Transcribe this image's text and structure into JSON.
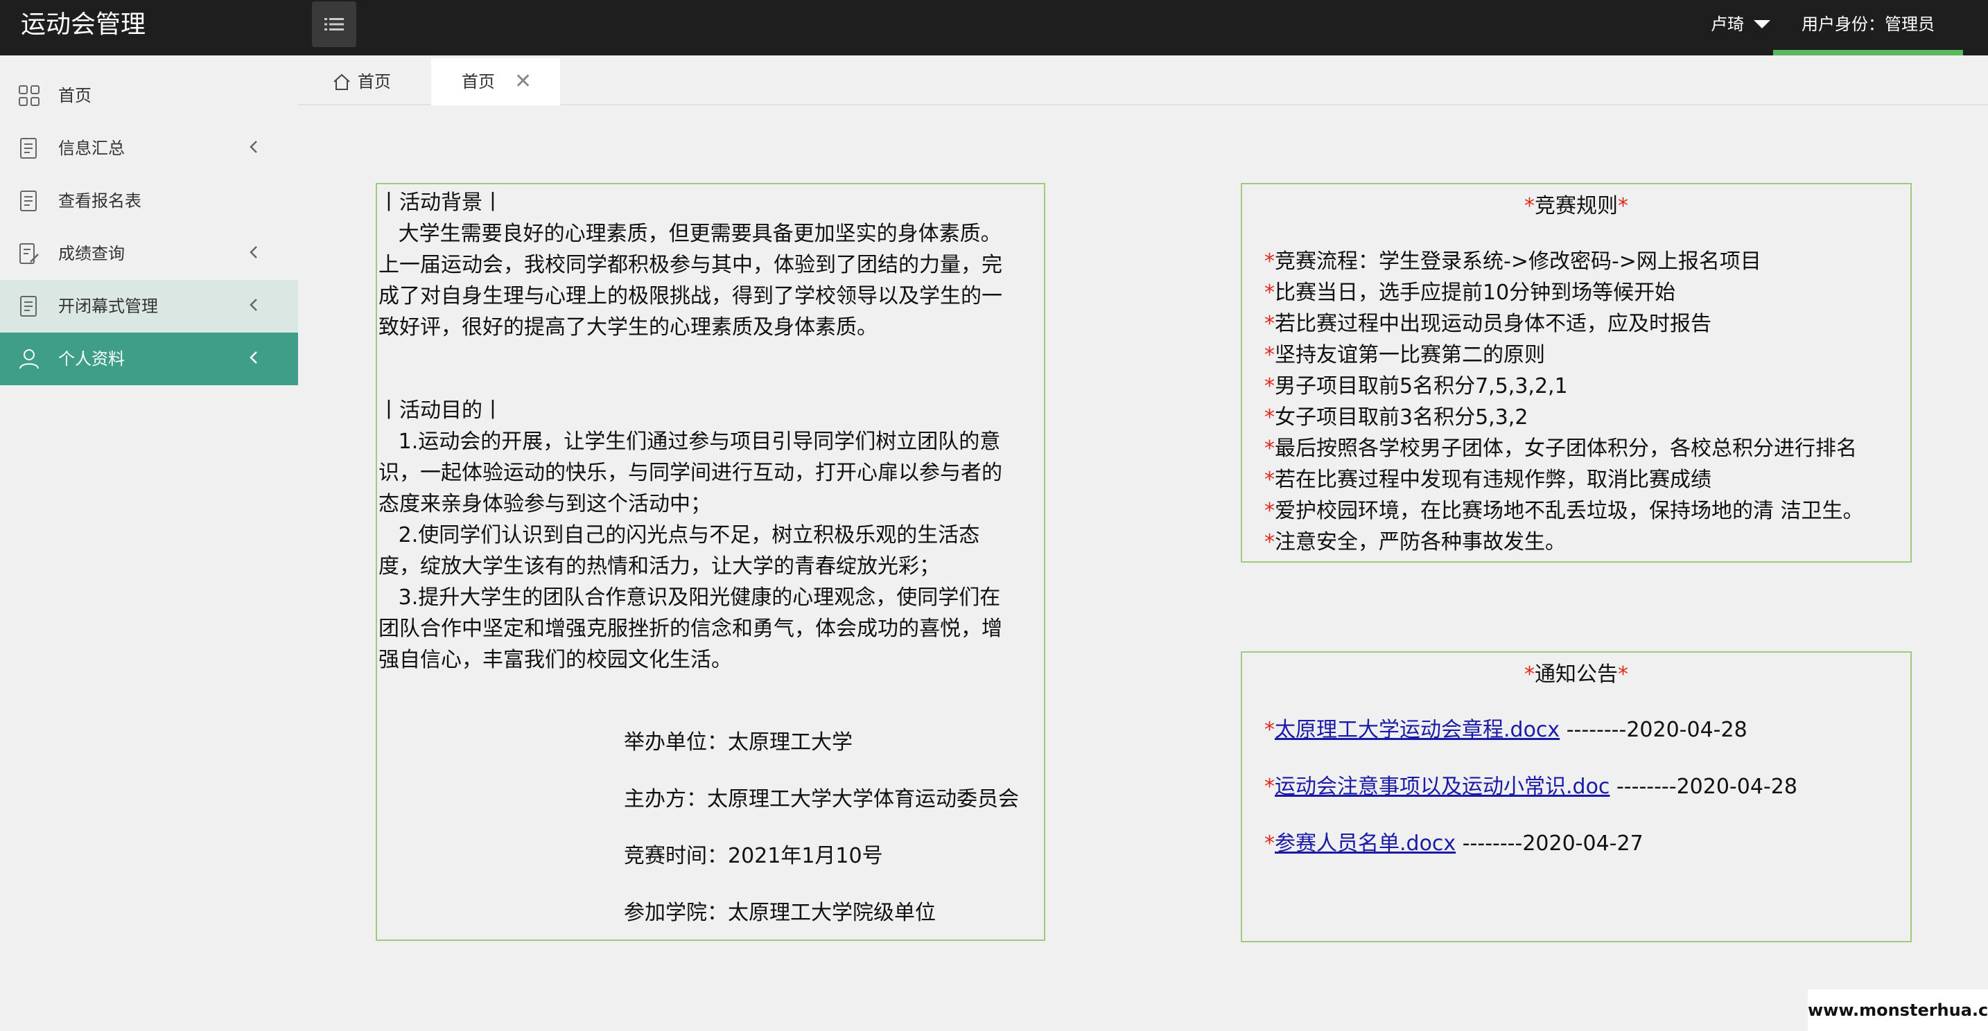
{
  "app": {
    "title": "运动会管理",
    "user_name": "卢琦",
    "role_label": "用户身份：管理员",
    "accent_color": "#3f9e87",
    "role_underline_color": "#5cb85c"
  },
  "sidebar": {
    "items": [
      {
        "label": "首页",
        "icon": "grid-icon",
        "has_chevron": false
      },
      {
        "label": "信息汇总",
        "icon": "document-icon",
        "has_chevron": true
      },
      {
        "label": "查看报名表",
        "icon": "document-icon",
        "has_chevron": false
      },
      {
        "label": "成绩查询",
        "icon": "edit-document-icon",
        "has_chevron": true
      },
      {
        "label": "开闭幕式管理",
        "icon": "document-icon",
        "has_chevron": true
      },
      {
        "label": "个人资料",
        "icon": "user-icon",
        "has_chevron": true
      }
    ]
  },
  "tabs": {
    "home_label": "首页",
    "active_label": "首页",
    "close_glyph": "✕"
  },
  "left_panel": {
    "background_title": "丨活动背景丨",
    "background_lines": [
      "   大学生需要良好的心理素质，但更需要具备更加坚实的身体素质。",
      "上一届运动会，我校同学都积极参与其中，体验到了团结的力量，完",
      "成了对自身生理与心理上的极限挑战，得到了学校领导以及学生的一",
      "致好评，很好的提高了大学生的心理素质及身体素质。"
    ],
    "purpose_title": "丨活动目的丨",
    "purpose_lines": [
      "   1.运动会的开展，让学生们通过参与项目引导同学们树立团队的意",
      "识，一起体验运动的快乐，与同学间进行互动，打开心扉以参与者的",
      "态度来亲身体验参与到这个活动中；",
      "   2.使同学们认识到自己的闪光点与不足，树立积极乐观的生活态",
      "度，绽放大学生该有的热情和活力，让大学的青春绽放光彩；",
      "   3.提升大学生的团队合作意识及阳光健康的心理观念，使同学们在",
      "团队合作中坚定和增强克服挫折的信念和勇气，体会成功的喜悦，增",
      "强自信心，丰富我们的校园文化生活。"
    ],
    "organizer": "举办单位：太原理工大学",
    "host": "主办方：太原理工大学大学体育运动委员会",
    "date": "竞赛时间：2021年1月10号",
    "colleges": "参加学院：太原理工大学院级单位"
  },
  "rules_panel": {
    "title": "竞赛规则",
    "rules": [
      "竞赛流程：学生登录系统->修改密码->网上报名项目",
      "比赛当日，选手应提前10分钟到场等候开始",
      "若比赛过程中出现运动员身体不适，应及时报告",
      "坚持友谊第一比赛第二的原则",
      "男子项目取前5名积分7,5,3,2,1",
      "女子项目取前3名积分5,3,2",
      "最后按照各学校男子团体，女子团体积分，各校总积分进行排名",
      "若在比赛过程中发现有违规作弊，取消比赛成绩",
      "爱护校园环境，在比赛场地不乱丢垃圾，保持场地的清 洁卫生。",
      "注意安全，严防各种事故发生。"
    ]
  },
  "notice_panel": {
    "title": "通知公告",
    "items": [
      {
        "link": "太原理工大学运动会章程.docx",
        "suffix": " --------2020-04-28"
      },
      {
        "link": "运动会注意事项以及运动小常识.doc",
        "suffix": " --------2020-04-28"
      },
      {
        "link": "参赛人员名单.docx",
        "suffix": " --------2020-04-27"
      }
    ]
  },
  "watermark": "www.monsterhua.com"
}
